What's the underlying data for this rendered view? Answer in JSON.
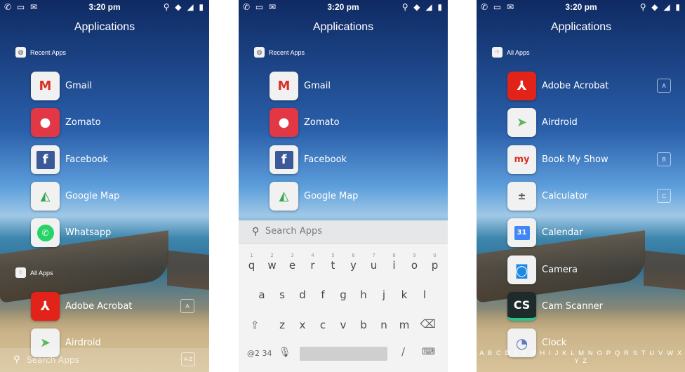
{
  "status": {
    "time": "3:20 pm"
  },
  "screens": [
    {
      "title": "Applications",
      "recent_label": "Recent Apps",
      "all_label": "All Apps",
      "recent_apps": [
        "Gmail",
        "Zomato",
        "Facebook",
        "Google Map",
        "Whatsapp"
      ],
      "all_apps": [
        "Adobe Acrobat",
        "Airdroid"
      ],
      "letters": [
        "A"
      ],
      "search_placeholder": "Search Apps",
      "az_button": "A-Z"
    },
    {
      "title": "Applications",
      "recent_label": "Recent Apps",
      "recent_apps": [
        "Gmail",
        "Zomato",
        "Facebook",
        "Google Map"
      ],
      "search_placeholder": "Search Apps",
      "keyboard": {
        "row1": [
          "q",
          "w",
          "e",
          "r",
          "t",
          "y",
          "u",
          "i",
          "o",
          "p"
        ],
        "row1_nums": [
          "1",
          "2",
          "3",
          "4",
          "5",
          "6",
          "7",
          "8",
          "9",
          "0"
        ],
        "row2": [
          "a",
          "s",
          "d",
          "f",
          "g",
          "h",
          "j",
          "k",
          "l"
        ],
        "row3": [
          "z",
          "x",
          "c",
          "v",
          "b",
          "n",
          "m"
        ],
        "symbols_key": "@2 34",
        "slash_key": "/"
      }
    },
    {
      "title": "Applications",
      "all_label": "All Apps",
      "apps": [
        "Adobe Acrobat",
        "Airdroid",
        "Book My Show",
        "Calculator",
        "Calendar",
        "Camera",
        "Cam Scanner",
        "Clock"
      ],
      "letters": [
        "A",
        "B",
        "C"
      ],
      "calendar_day": "31",
      "alphabet": "A B C D E F G H I J K L M N O P Q R S T U V W X Y Z"
    }
  ],
  "icons": {
    "gmail": "gmail-icon",
    "zomato": "zomato-icon",
    "facebook": "facebook-icon",
    "maps": "google-maps-icon",
    "whatsapp": "whatsapp-icon",
    "acrobat": "adobe-acrobat-icon",
    "airdroid": "airdroid-icon",
    "bookmyshow": "book-my-show-icon",
    "calculator": "calculator-icon",
    "calendar": "calendar-icon",
    "camera": "camera-icon",
    "camscanner": "cam-scanner-icon",
    "clock": "clock-icon"
  },
  "colors": {
    "gmail_red": "#d93025",
    "zomato_red": "#e23744",
    "facebook_blue": "#3b5998",
    "whatsapp_green": "#25d366",
    "acrobat_red": "#e2231a"
  }
}
